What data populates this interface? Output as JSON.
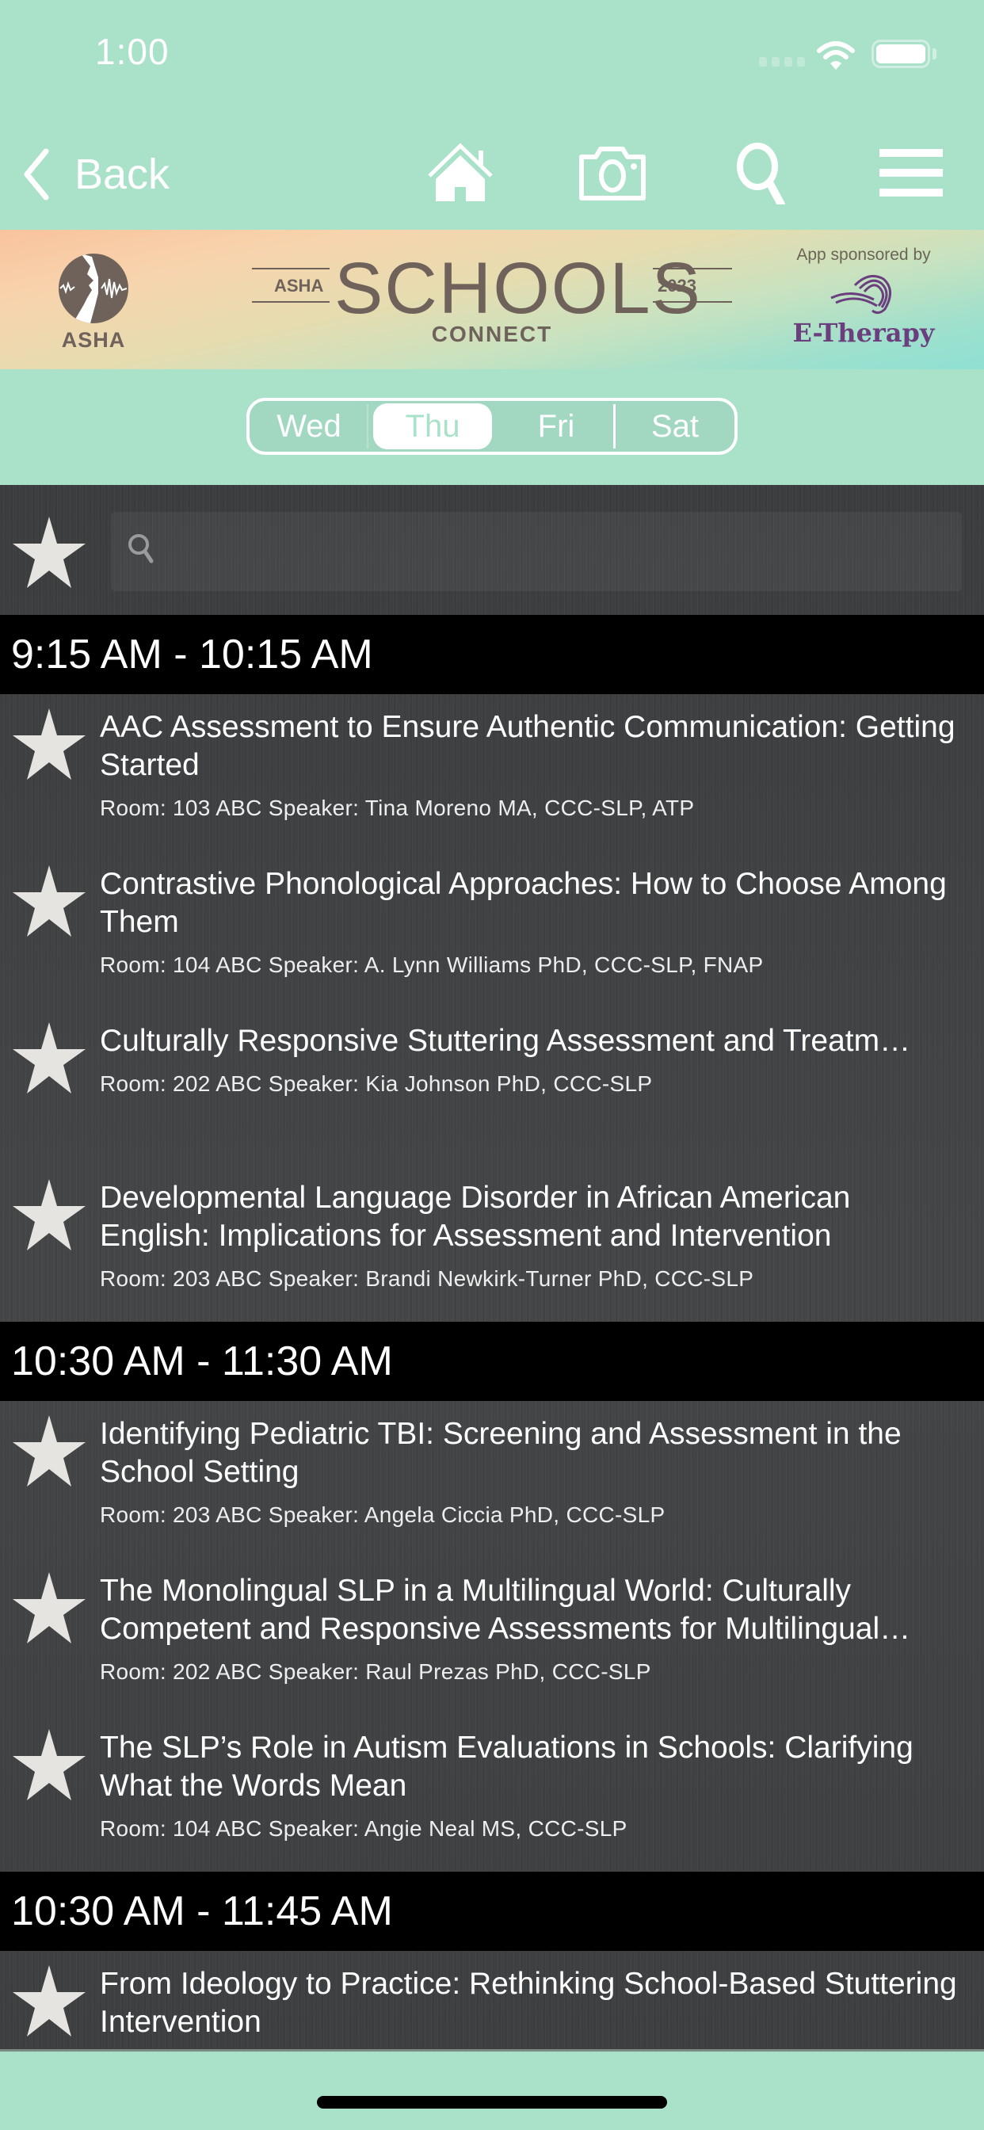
{
  "status_bar": {
    "time": "1:00",
    "icons": [
      "signal-icon",
      "wifi-icon",
      "battery-icon"
    ]
  },
  "nav": {
    "back_label": "Back",
    "icons": [
      "home-icon",
      "camera-icon",
      "search-icon",
      "menu-icon"
    ]
  },
  "banner": {
    "left_logo_text": "ASHA",
    "title_prefix": "ASHA",
    "title_main": "SCHOOLS",
    "title_year": "2023",
    "title_sub": "CONNECT",
    "sponsor_label": "App sponsored by",
    "sponsor_name": "E-Therapy"
  },
  "days": {
    "options": [
      "Wed",
      "Thu",
      "Fri",
      "Sat"
    ],
    "selected": "Thu"
  },
  "search": {
    "placeholder": "",
    "value": ""
  },
  "colors": {
    "app_bg": "#a9e1c9",
    "list_bg": "#3f4143",
    "header_bg": "#000000",
    "star": "#e6e4e0",
    "sponsor_purple": "#6b3f7e",
    "logo_brown": "#6e625b"
  },
  "schedule": [
    {
      "time": "9:15 AM - 10:15 AM",
      "sessions": [
        {
          "title": "AAC Assessment to Ensure Authentic Communication: Getting Started",
          "meta": "Room: 103 ABC Speaker: Tina Moreno MA, CCC-SLP, ATP"
        },
        {
          "title": "Contrastive Phonological Approaches: How to Choose Among Them",
          "meta": "Room: 104 ABC Speaker: A. Lynn Williams PhD, CCC-SLP, FNAP"
        },
        {
          "title": "Culturally Responsive Stuttering Assessment and Treatm…",
          "meta": "Room: 202 ABC Speaker: Kia Johnson PhD, CCC-SLP"
        },
        {
          "title": "Developmental Language Disorder in African American English: Implications for Assessment and Intervention",
          "meta": "Room: 203 ABC Speaker: Brandi Newkirk-Turner PhD, CCC-SLP"
        }
      ]
    },
    {
      "time": "10:30 AM - 11:30 AM",
      "sessions": [
        {
          "title": "Identifying Pediatric TBI: Screening and Assessment in the School Setting",
          "meta": "Room: 203 ABC Speaker: Angela Ciccia PhD, CCC-SLP"
        },
        {
          "title": "The Monolingual SLP in a Multilingual World: Culturally Competent and Responsive Assessments for Multilingual…",
          "meta": "Room: 202 ABC Speaker: Raul Prezas PhD, CCC-SLP"
        },
        {
          "title": "The SLP’s Role in Autism Evaluations in Schools: Clarifying What the Words Mean",
          "meta": "Room: 104 ABC Speaker: Angie Neal MS, CCC-SLP"
        }
      ]
    },
    {
      "time": "10:30 AM - 11:45 AM",
      "sessions": [
        {
          "title": "From Ideology to Practice: Rethinking School-Based Stuttering Intervention",
          "meta": ""
        }
      ]
    }
  ]
}
